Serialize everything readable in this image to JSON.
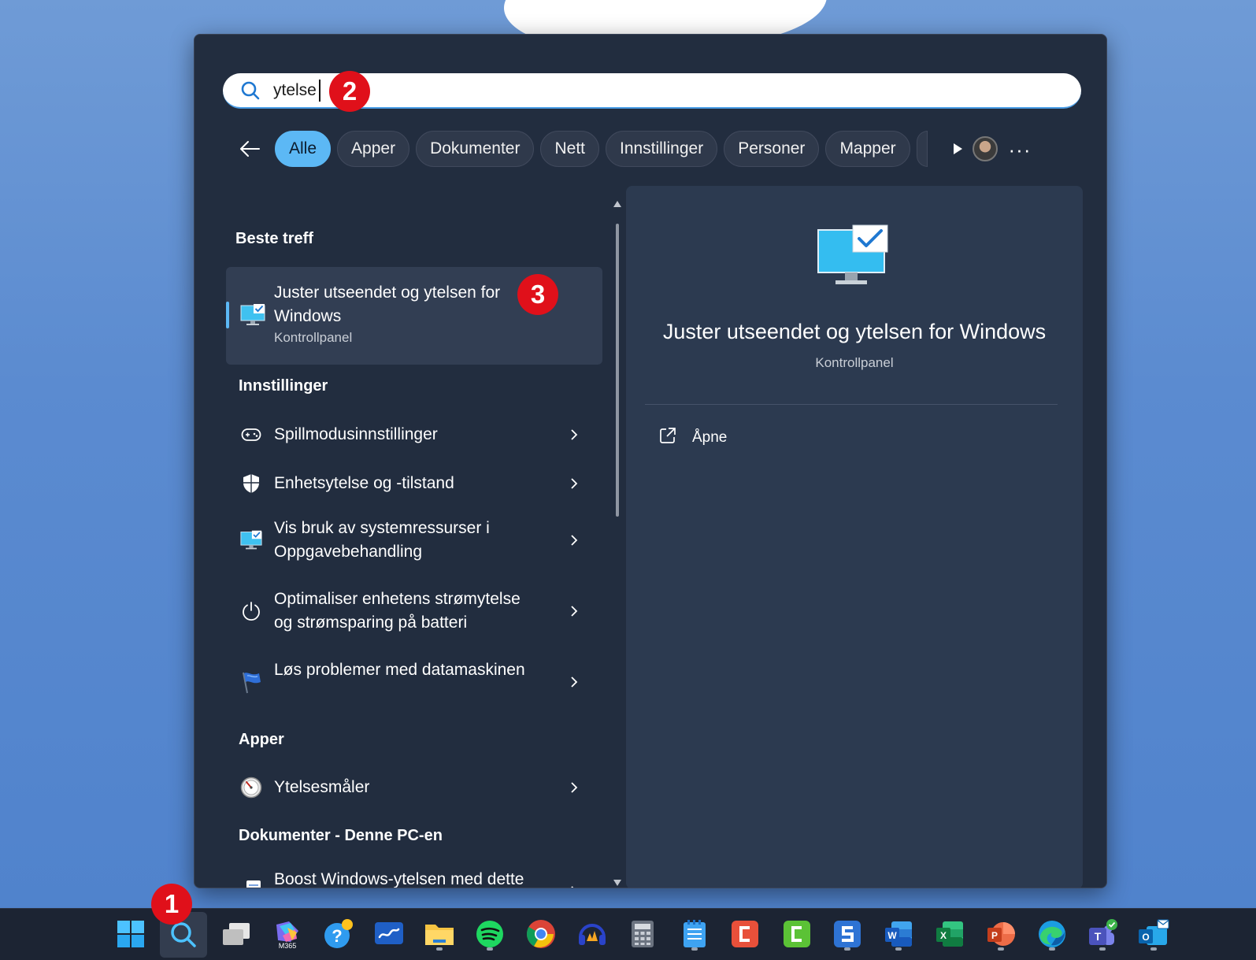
{
  "search": {
    "query": "ytelse",
    "callouts": [
      "1",
      "2",
      "3"
    ]
  },
  "filters": {
    "chips": [
      "Alle",
      "Apper",
      "Dokumenter",
      "Nett",
      "Innstillinger",
      "Personer",
      "Mapper"
    ],
    "active": "Alle",
    "more_label": "···"
  },
  "results": {
    "best_match_heading": "Beste treff",
    "best_match": {
      "title": "Juster utseendet og ytelsen for Windows",
      "subtitle": "Kontrollpanel"
    },
    "settings_heading": "Innstillinger",
    "settings": [
      {
        "label": "Spillmodusinnstillinger",
        "icon": "gamepad-icon"
      },
      {
        "label": "Enhetsytelse og -tilstand",
        "icon": "shield-icon"
      },
      {
        "label": "Vis bruk av systemressurser i Oppgavebehandling",
        "icon": "monitor-check-icon"
      },
      {
        "label": "Optimaliser enhetens strømytelse og strømsparing på batteri",
        "icon": "power-icon"
      },
      {
        "label": "Løs problemer med datamaskinen",
        "icon": "flag-icon"
      }
    ],
    "apps_heading": "Apper",
    "apps": [
      {
        "label": "Ytelsesmåler",
        "icon": "gauge-icon"
      }
    ],
    "docs_heading": "Dokumenter - Denne PC-en",
    "docs": [
      {
        "label": "Boost Windows-ytelsen med dette smarte trikse.docx",
        "icon": "word-doc-icon"
      }
    ]
  },
  "preview": {
    "title": "Juster utseendet og ytelsen for Windows",
    "subtitle": "Kontrollpanel",
    "action": "Åpne"
  },
  "taskbar": {
    "apps": [
      "start-icon",
      "search-icon",
      "task-view-icon",
      "m365-icon",
      "help-icon",
      "whiteboard-icon",
      "file-explorer-icon",
      "spotify-icon",
      "chrome-icon",
      "audio-app-icon",
      "calculator-icon",
      "notepad-icon",
      "camtasia-icon",
      "camtasia-green-icon",
      "snagit-icon",
      "word-icon",
      "excel-icon",
      "powerpoint-icon",
      "edge-icon",
      "teams-icon",
      "outlook-icon"
    ],
    "m365_label": "M365"
  },
  "colors": {
    "accent": "#5cb8f5",
    "panel": "#222d3f",
    "callout": "#e0101a"
  }
}
